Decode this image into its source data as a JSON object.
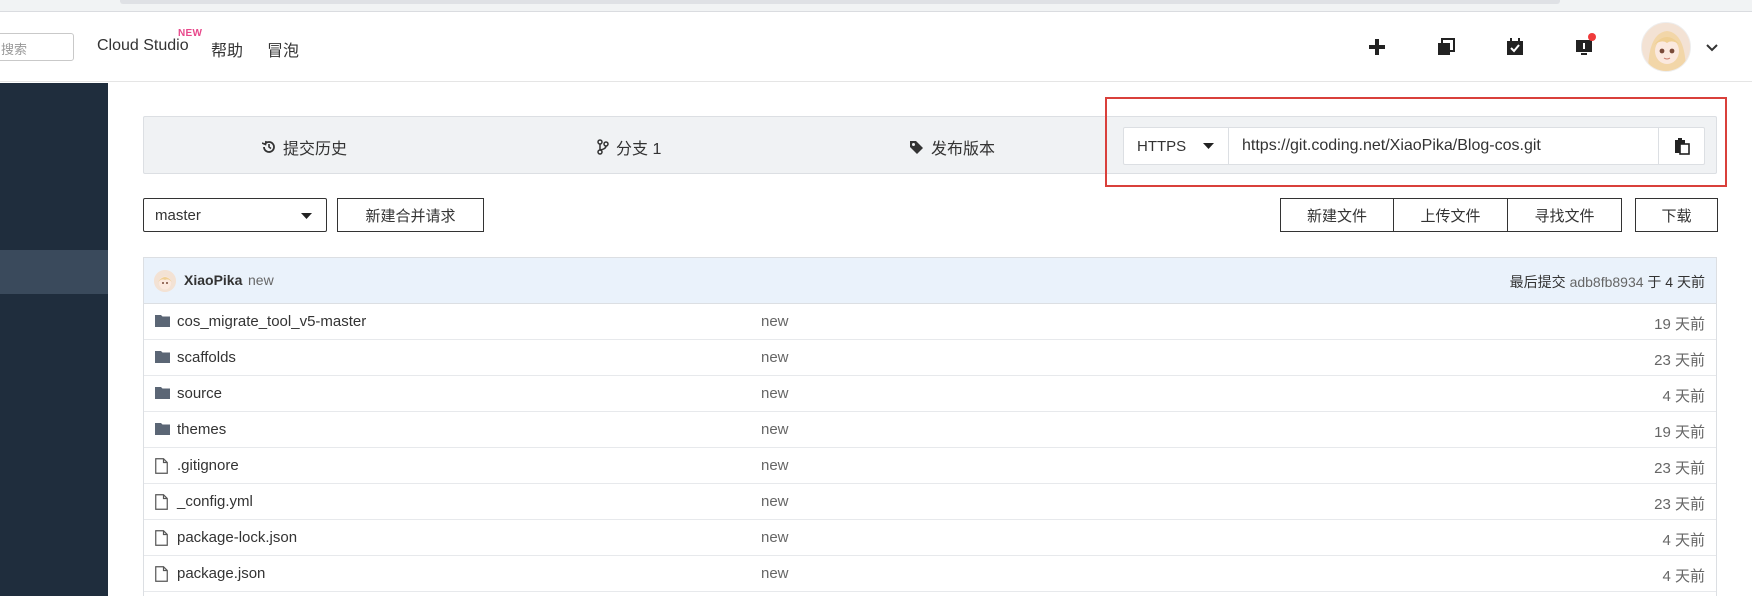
{
  "header": {
    "search_placeholder": "搜索",
    "links": [
      {
        "label": "Cloud Studio",
        "badge": "NEW"
      },
      {
        "label": "帮助"
      },
      {
        "label": "冒泡"
      }
    ],
    "icons": [
      "plus-icon",
      "copy-windows-icon",
      "calendar-check-icon",
      "notification-icon"
    ]
  },
  "repo_nav": {
    "tabs": [
      {
        "icon": "history-icon",
        "label": "提交历史"
      },
      {
        "icon": "branch-icon",
        "label": "分支 1"
      },
      {
        "icon": "tag-icon",
        "label": "发布版本"
      }
    ],
    "clone": {
      "protocol": "HTTPS",
      "url": "https://git.coding.net/XiaoPika/Blog-cos.git"
    }
  },
  "controls": {
    "branch": "master",
    "merge_request": "新建合并请求",
    "actions": [
      "新建文件",
      "上传文件",
      "寻找文件"
    ],
    "download": "下载"
  },
  "commit": {
    "user": "XiaoPika",
    "message": "new",
    "prefix": "最后提交",
    "hash": "adb8fb8934",
    "time": "于 4 天前"
  },
  "files": [
    {
      "type": "folder",
      "name": "cos_migrate_tool_v5-master",
      "message": "new",
      "time": "19 天前"
    },
    {
      "type": "folder",
      "name": "scaffolds",
      "message": "new",
      "time": "23 天前"
    },
    {
      "type": "folder",
      "name": "source",
      "message": "new",
      "time": "4 天前"
    },
    {
      "type": "folder",
      "name": "themes",
      "message": "new",
      "time": "19 天前"
    },
    {
      "type": "file",
      "name": ".gitignore",
      "message": "new",
      "time": "23 天前"
    },
    {
      "type": "file",
      "name": "_config.yml",
      "message": "new",
      "time": "23 天前"
    },
    {
      "type": "file",
      "name": "package-lock.json",
      "message": "new",
      "time": "4 天前"
    },
    {
      "type": "file",
      "name": "package.json",
      "message": "new",
      "time": "4 天前"
    }
  ],
  "colors": {
    "sidebar": "#1f2d3d",
    "highlight": "#d9403b",
    "commit_bar": "#eaf2fb",
    "new_badge": "#e8488b"
  }
}
